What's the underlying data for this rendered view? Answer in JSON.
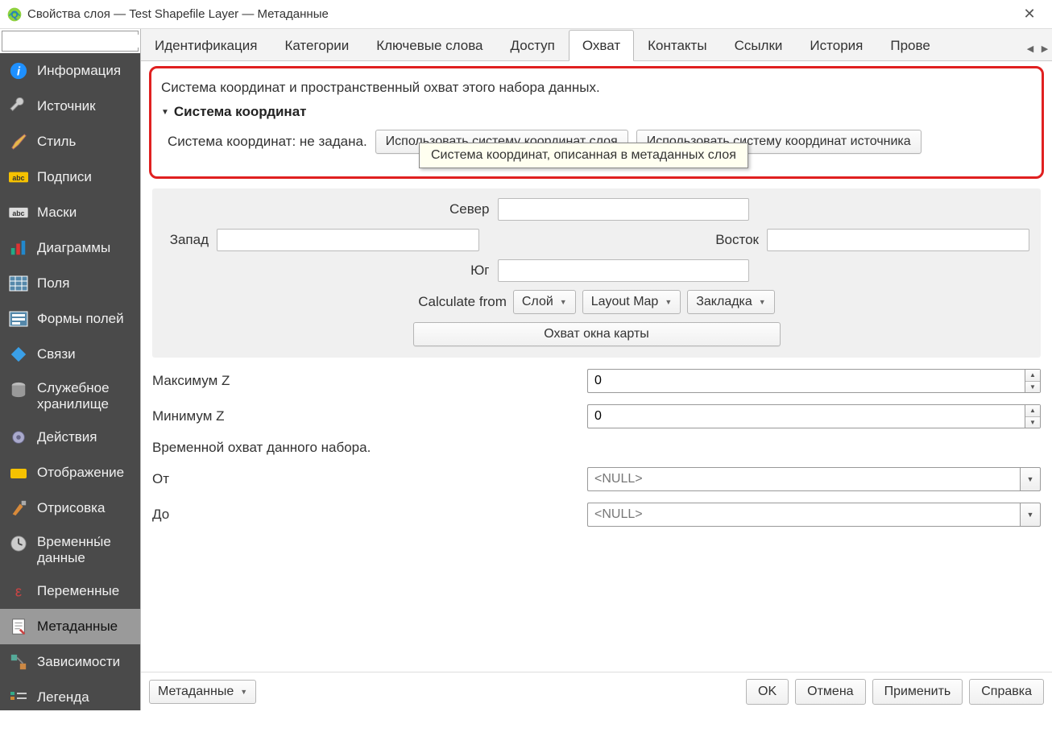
{
  "window": {
    "title": "Свойства слоя — Test Shapefile Layer — Метаданные"
  },
  "search": {
    "placeholder": ""
  },
  "sidebar": {
    "items": [
      {
        "label": "Информация"
      },
      {
        "label": "Источник"
      },
      {
        "label": "Стиль"
      },
      {
        "label": "Подписи"
      },
      {
        "label": "Маски"
      },
      {
        "label": "Диаграммы"
      },
      {
        "label": "Поля"
      },
      {
        "label": "Формы полей"
      },
      {
        "label": "Связи"
      },
      {
        "label": "Служебное хранилище"
      },
      {
        "label": "Действия"
      },
      {
        "label": "Отображение"
      },
      {
        "label": "Отрисовка"
      },
      {
        "label": "Временны́е данные"
      },
      {
        "label": "Переменные"
      },
      {
        "label": "Метаданные"
      },
      {
        "label": "Зависимости"
      },
      {
        "label": "Легенда"
      }
    ]
  },
  "tabs": {
    "items": [
      "Идентификация",
      "Категории",
      "Ключевые слова",
      "Доступ",
      "Охват",
      "Контакты",
      "Ссылки",
      "История",
      "Прове"
    ],
    "active_index": 4
  },
  "panel": {
    "intro": "Система координат и пространственный охват этого набора данных.",
    "crs_section_title": "Система координат",
    "crs_status": "Система координат: не задана.",
    "btn_use_layer_crs": "Использовать систему координат слоя",
    "btn_use_source_crs": "Использовать систему координат источника",
    "tooltip": "Система координат, описанная в метаданных слоя",
    "extent": {
      "north": "Север",
      "west": "Запад",
      "east": "Восток",
      "south": "Юг",
      "calculate_from": "Calculate from",
      "dd_layer": "Слой",
      "dd_layout": "Layout Map",
      "dd_bookmark": "Закладка",
      "canvas_extent_btn": "Охват окна карты"
    },
    "z_max_label": "Максимум Z",
    "z_min_label": "Минимум Z",
    "z_max_value": "0",
    "z_min_value": "0",
    "temporal_heading": "Временной охват данного набора.",
    "from_label": "От",
    "to_label": "До",
    "null_text": "<NULL>"
  },
  "bottom": {
    "metadata_menu": "Метаданные",
    "ok": "OK",
    "cancel": "Отмена",
    "apply": "Применить",
    "help": "Справка"
  }
}
